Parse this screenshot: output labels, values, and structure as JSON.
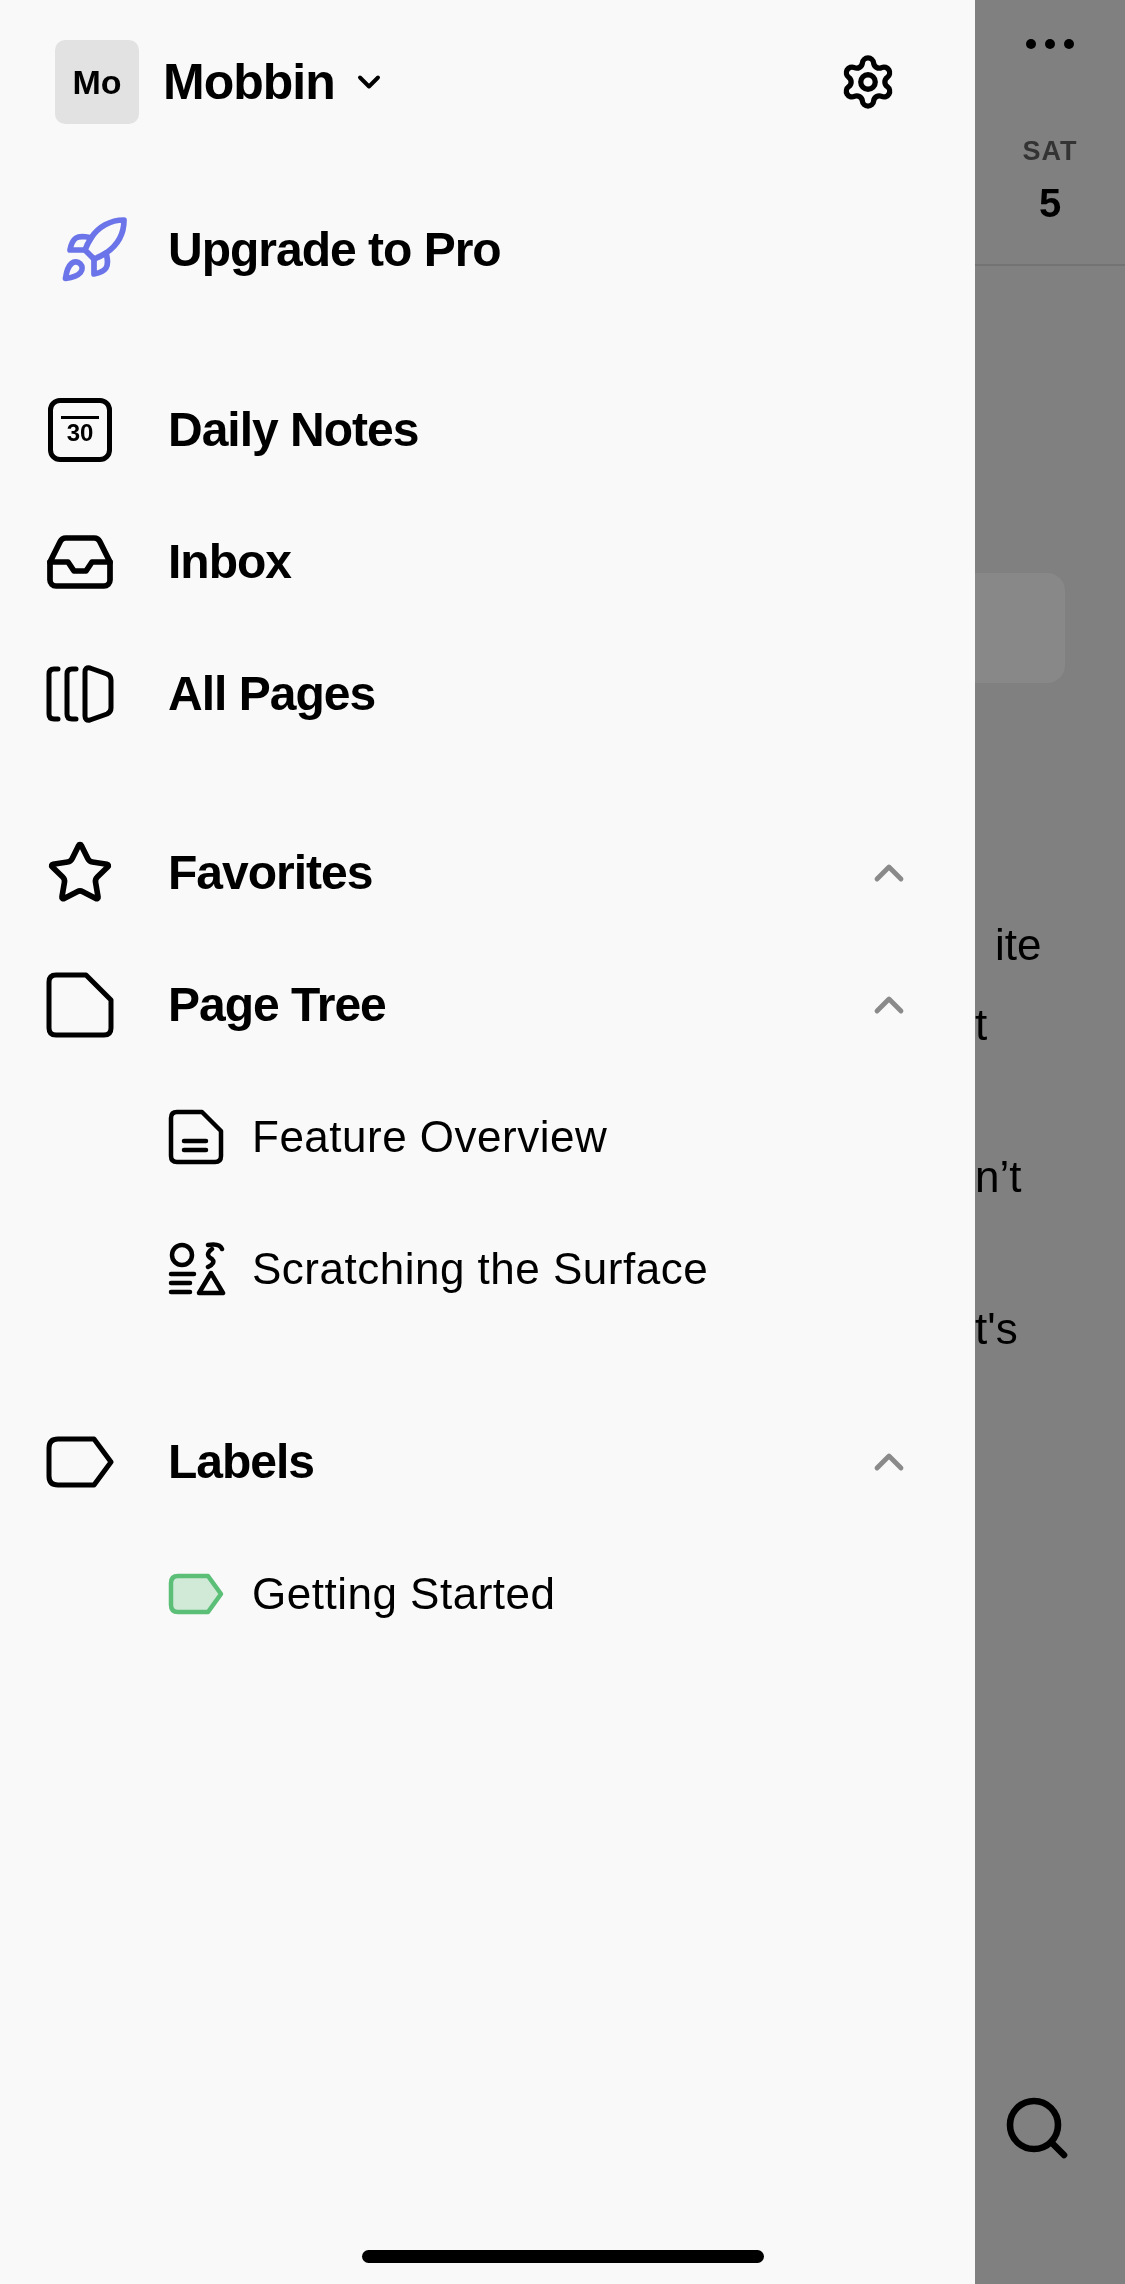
{
  "workspace": {
    "avatar": "Mo",
    "name": "Mobbin"
  },
  "upgrade": {
    "label": "Upgrade to Pro"
  },
  "nav": [
    {
      "kind": "calendar",
      "label": "Daily Notes",
      "calendar_day": "30"
    },
    {
      "kind": "inbox",
      "label": "Inbox"
    },
    {
      "kind": "pages",
      "label": "All Pages"
    }
  ],
  "sections": [
    {
      "kind": "star",
      "label": "Favorites",
      "expanded": true
    },
    {
      "kind": "page",
      "label": "Page Tree",
      "expanded": true,
      "children": [
        {
          "kind": "document",
          "label": "Feature Overview"
        },
        {
          "kind": "shapes",
          "label": "Scratching the Surface"
        }
      ]
    },
    {
      "kind": "tag",
      "label": "Labels",
      "expanded": true,
      "children": [
        {
          "kind": "label",
          "label": "Getting Started",
          "color": "#5cbf77"
        }
      ]
    }
  ],
  "background": {
    "day_name": "SAT",
    "day_number": "5",
    "text_fragments": [
      "ite",
      "t",
      "n’t",
      "t's"
    ]
  }
}
